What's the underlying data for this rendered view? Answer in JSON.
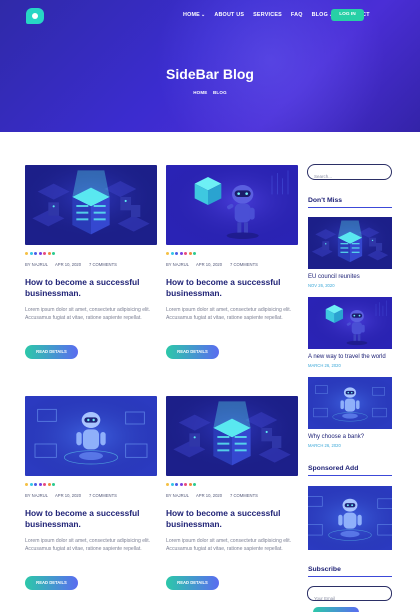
{
  "header": {
    "nav": [
      {
        "label": "HOME",
        "dropdown": true
      },
      {
        "label": "ABOUT US",
        "dropdown": false
      },
      {
        "label": "SERVICES",
        "dropdown": false
      },
      {
        "label": "FAQ",
        "dropdown": false
      },
      {
        "label": "BLOG",
        "dropdown": true
      },
      {
        "label": "CONTACT",
        "dropdown": false
      }
    ],
    "login_label": "LOG IN"
  },
  "hero": {
    "title": "SideBar Blog",
    "breadcrumb": [
      "HOME",
      "BLOG"
    ]
  },
  "dot_colors": [
    "#f5c044",
    "#35c6e8",
    "#4a5de6",
    "#7a3fe0",
    "#e84a7f",
    "#f08a3a",
    "#2ccb8f"
  ],
  "posts": [
    {
      "image": "isometric-server",
      "author": "BY NAJRUL",
      "date": "APR 10, 2020",
      "comments": "7 COMMENTS",
      "title": "How to become a successful businessman.",
      "excerpt": "Lorem ipsum dolor sit amet, consectetur adipisicing elit. Accusamus fugiat at vitae, ratione sapiente repellat.",
      "button": "READ DETAILS"
    },
    {
      "image": "robot-cube",
      "author": "BY NAJRUL",
      "date": "APR 10, 2020",
      "comments": "7 COMMENTS",
      "title": "How to become a successful businessman.",
      "excerpt": "Lorem ipsum dolor sit amet, consectetur adipisicing elit. Accusamus fugiat at vitae, ratione sapiente repellat.",
      "button": "READ DETAILS"
    },
    {
      "image": "robot-screens",
      "author": "BY NAJRUL",
      "date": "APR 10, 2020",
      "comments": "7 COMMENTS",
      "title": "How to become a successful businessman.",
      "excerpt": "Lorem ipsum dolor sit amet, consectetur adipisicing elit. Accusamus fugiat at vitae, ratione sapiente repellat.",
      "button": "READ DETAILS"
    },
    {
      "image": "isometric-server",
      "author": "BY NAJRUL",
      "date": "APR 10, 2020",
      "comments": "7 COMMENTS",
      "title": "How to become a successful businessman.",
      "excerpt": "Lorem ipsum dolor sit amet, consectetur adipisicing elit. Accusamus fugiat at vitae, ratione sapiente repellat.",
      "button": "READ DETAILS"
    }
  ],
  "sidebar": {
    "search_placeholder": "Search...",
    "dont_miss_heading": "Don't Miss",
    "items": [
      {
        "image": "isometric-server",
        "title": "EU council reunites",
        "date": "NOV 26, 2020"
      },
      {
        "image": "robot-cube",
        "title": "A new way to travel the world",
        "date": "MARCH 26, 2020"
      },
      {
        "image": "robot-screens",
        "title": "Why choose a bank?",
        "date": "MARCH 26, 2020"
      }
    ],
    "sponsored_heading": "Sponsored Add",
    "sponsored_image": "robot-screens",
    "subscribe_heading": "Subscribe",
    "email_placeholder": "Your Email"
  }
}
